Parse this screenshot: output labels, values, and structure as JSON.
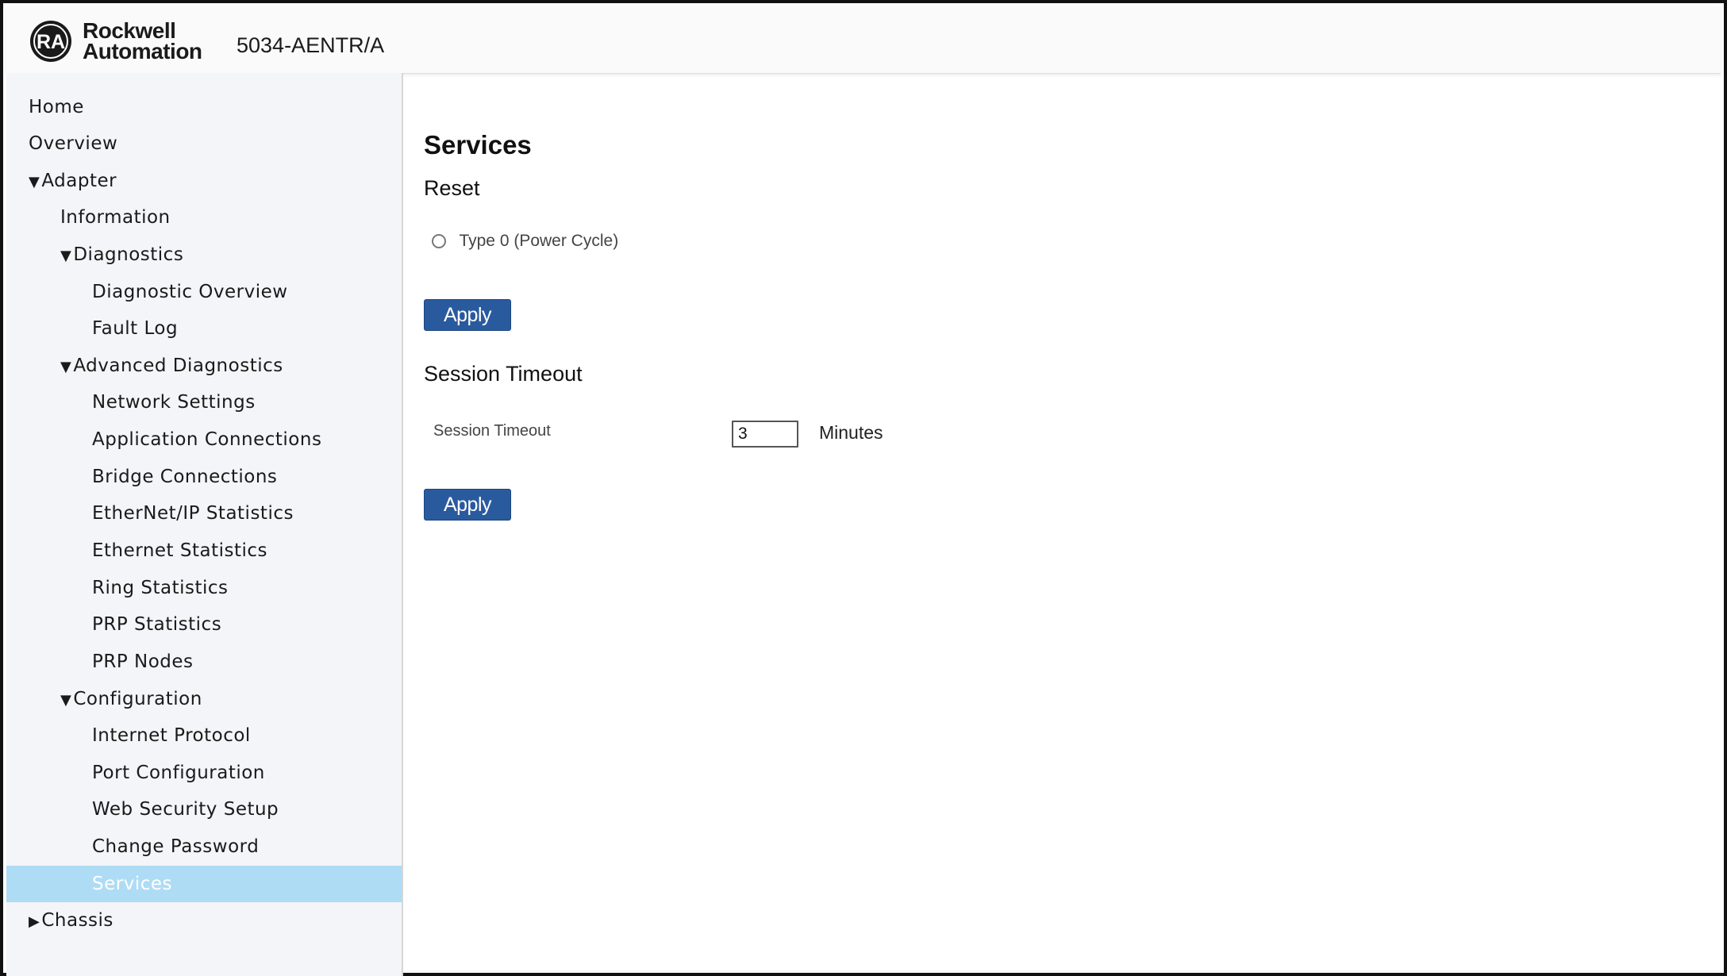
{
  "header": {
    "logo_mark": "RA",
    "logo_line1": "Rockwell",
    "logo_line2": "Automation",
    "device": "5034-AENTR/A"
  },
  "sidebar": {
    "items": [
      {
        "label": "Home"
      },
      {
        "label": "Overview"
      },
      {
        "label": "Adapter",
        "caret": "▼"
      },
      {
        "label": "Information"
      },
      {
        "label": "Diagnostics",
        "caret": "▼"
      },
      {
        "label": "Diagnostic Overview"
      },
      {
        "label": "Fault Log"
      },
      {
        "label": "Advanced Diagnostics",
        "caret": "▼"
      },
      {
        "label": "Network Settings"
      },
      {
        "label": "Application Connections"
      },
      {
        "label": "Bridge Connections"
      },
      {
        "label": "EtherNet/IP Statistics"
      },
      {
        "label": "Ethernet Statistics"
      },
      {
        "label": "Ring Statistics"
      },
      {
        "label": "PRP Statistics"
      },
      {
        "label": "PRP Nodes"
      },
      {
        "label": "Configuration",
        "caret": "▼"
      },
      {
        "label": "Internet Protocol"
      },
      {
        "label": "Port Configuration"
      },
      {
        "label": "Web Security Setup"
      },
      {
        "label": "Change Password"
      },
      {
        "label": "Services",
        "selected": true
      },
      {
        "label": "Chassis",
        "caret": "▶"
      }
    ]
  },
  "main": {
    "title": "Services",
    "reset": {
      "heading": "Reset",
      "option_label": "Type 0 (Power Cycle)",
      "option_selected": false,
      "apply_label": "Apply"
    },
    "session": {
      "heading": "Session Timeout",
      "field_label": "Session Timeout",
      "value": "3",
      "unit": "Minutes",
      "apply_label": "Apply"
    }
  },
  "colors": {
    "selected_bg": "#aedcf5",
    "button_bg": "#2a5a9e",
    "sidebar_bg": "#f3f5f8"
  }
}
